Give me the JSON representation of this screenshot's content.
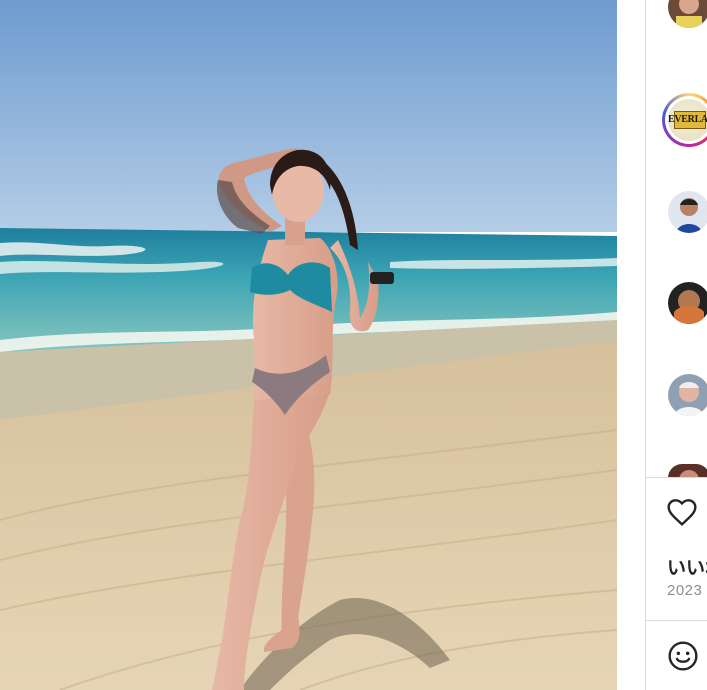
{
  "post": {
    "photo_alt": "beach-photo"
  },
  "sidebar": {
    "brand_avatar_text": "EVERLAST",
    "likes_label": "いいね",
    "date": "2023"
  },
  "colors": {
    "border": "#dbdbdb",
    "text_dark": "#262626",
    "text_muted": "#8e8e8e",
    "sky_top": "#7fa9d6",
    "sea": "#3c9fb0",
    "sand": "#dcc7a3"
  }
}
